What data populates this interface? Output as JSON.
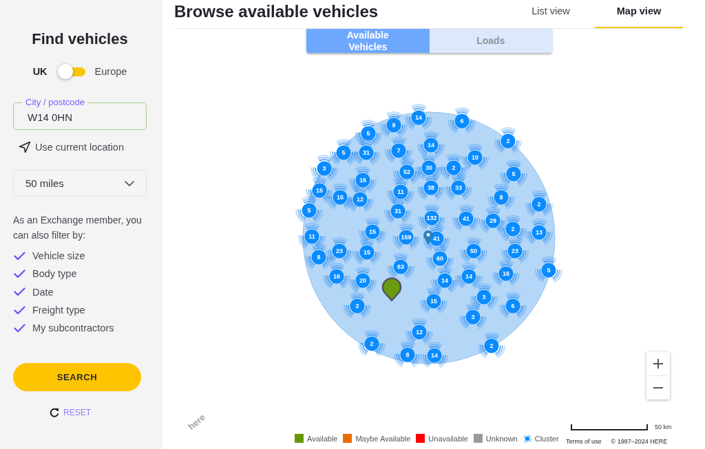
{
  "sidebar": {
    "title": "Find vehicles",
    "region_switch": [
      {
        "label": "UK",
        "selected": true
      },
      {
        "label": "Europe",
        "selected": false
      }
    ],
    "location_field": {
      "label": "City / postcode",
      "value": "W14 0HN"
    },
    "current_location_link": "Use current location",
    "radius_select": {
      "value": "50 miles"
    },
    "filter_intro": "As an Exchange member, you can also filter by:",
    "filters": [
      "Vehicle size",
      "Body type",
      "Date",
      "Freight type",
      "My subcontractors"
    ],
    "search_button": "SEARCH",
    "reset_link": "RESET"
  },
  "header": {
    "title": "Browse available vehicles",
    "tabs": [
      {
        "label": "List view",
        "selected": false
      },
      {
        "label": "Map view",
        "selected": true
      }
    ]
  },
  "map": {
    "mode_toggle": [
      {
        "label": "Available Vehicles",
        "selected": true
      },
      {
        "label": "Loads",
        "selected": false
      }
    ],
    "clusters": [
      "14",
      "6",
      "9",
      "5",
      "2",
      "14",
      "5",
      "31",
      "7",
      "10",
      "3",
      "30",
      "2",
      "52",
      "5",
      "16",
      "38",
      "33",
      "15",
      "11",
      "15",
      "12",
      "8",
      "2",
      "5",
      "31",
      "132",
      "41",
      "29",
      "2",
      "13",
      "15",
      "11",
      "159",
      "41",
      "23",
      "15",
      "50",
      "23",
      "8",
      "60",
      "63",
      "5",
      "16",
      "20",
      "14",
      "14",
      "16",
      "2",
      "15",
      "3",
      "6",
      "3",
      "12",
      "2",
      "2",
      "8",
      "14"
    ],
    "logo": "here",
    "legend": [
      {
        "kind": "swatch",
        "label": "Available",
        "color": "#669900"
      },
      {
        "kind": "swatch",
        "label": "Maybe Available",
        "color": "#ea6c00"
      },
      {
        "kind": "swatch",
        "label": "Unavailable",
        "color": "#ff0000"
      },
      {
        "kind": "swatch",
        "label": "Unknown",
        "color": "#9e9a9a"
      },
      {
        "kind": "cluster",
        "label": "Cluster"
      }
    ],
    "scale": "50 km",
    "terms_link": "Terms of use",
    "copyright": "© 1987–2024 HERE"
  }
}
